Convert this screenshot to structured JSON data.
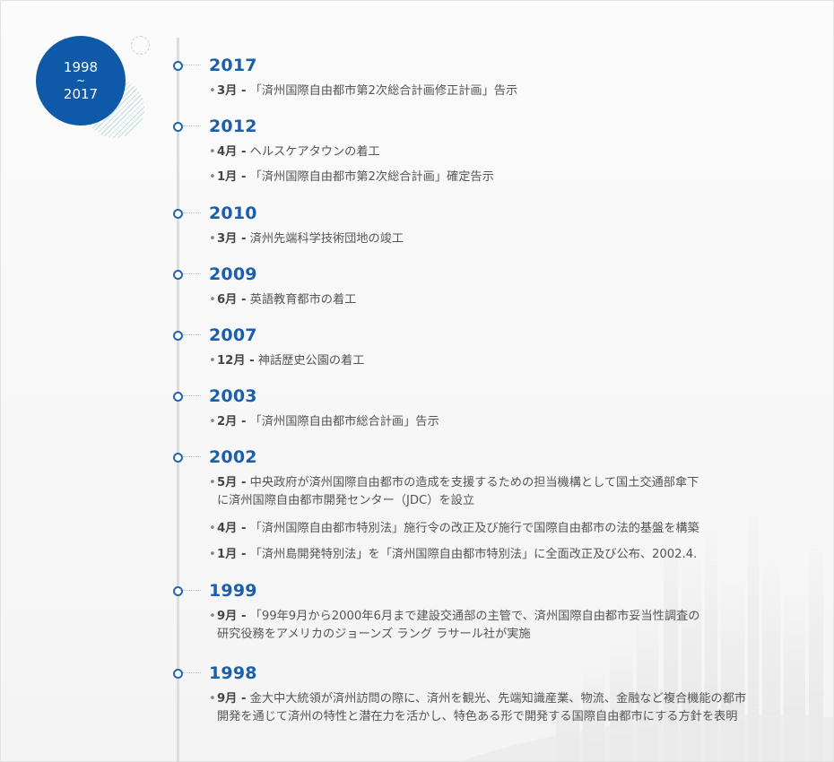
{
  "badge": {
    "start": "1998",
    "tilde": "~",
    "end": "2017"
  },
  "bullet": "•",
  "timeline": [
    {
      "year": "2017",
      "items": [
        {
          "month": "3月 -",
          "lines": [
            "「済州国際自由都市第2次総合計画修正計画」告示"
          ]
        }
      ]
    },
    {
      "year": "2012",
      "items": [
        {
          "month": "4月 -",
          "lines": [
            "ヘルスケアタウンの着工"
          ]
        },
        {
          "month": "1月 -",
          "lines": [
            "「済州国際自由都市第2次総合計画」確定告示"
          ]
        }
      ]
    },
    {
      "year": "2010",
      "items": [
        {
          "month": "3月 -",
          "lines": [
            "済州先端科学技術団地の竣工"
          ]
        }
      ]
    },
    {
      "year": "2009",
      "items": [
        {
          "month": "6月 -",
          "lines": [
            "英語教育都市の着工"
          ]
        }
      ]
    },
    {
      "year": "2007",
      "items": [
        {
          "month": "12月 -",
          "lines": [
            "神話歴史公園の着工"
          ]
        }
      ]
    },
    {
      "year": "2003",
      "items": [
        {
          "month": "2月 -",
          "lines": [
            "「済州国際自由都市総合計画」告示"
          ]
        }
      ]
    },
    {
      "year": "2002",
      "items": [
        {
          "month": "5月 -",
          "lines": [
            "中央政府が済州国際自由都市の造成を支援するための担当機構として国土交通部傘下",
            "に済州国際自由都市開発センター（JDC）を設立"
          ]
        },
        {
          "month": "4月 -",
          "lines": [
            "「済州国際自由都市特別法」施行令の改正及び施行で国際自由都市の法的基盤を構築"
          ]
        },
        {
          "month": "1月 -",
          "lines": [
            "「済州島開発特別法」を「済州国際自由都市特別法」に全面改正及び公布、2002.4."
          ]
        }
      ]
    },
    {
      "year": "1999",
      "items": [
        {
          "month": "9月 -",
          "lines": [
            "「99年9月から2000年6月まで建設交通部の主管で、済州国際自由都市妥当性調査の",
            "研究役務をアメリカのジョーンズ ラング ラサール社が実施"
          ]
        }
      ]
    },
    {
      "year": "1998",
      "items": [
        {
          "month": "9月 -",
          "lines": [
            "金大中大統領が済州訪問の際に、済州を観光、先端知識産業、物流、金融など複合機能の都市",
            "開発を通じて済州の特性と潜在力を活かし、特色ある形で開発する国際自由都市にする方針を表明"
          ]
        }
      ]
    }
  ],
  "colors": {
    "accent": "#0f5aa8",
    "node": "#2166b0",
    "text": "#555555"
  }
}
